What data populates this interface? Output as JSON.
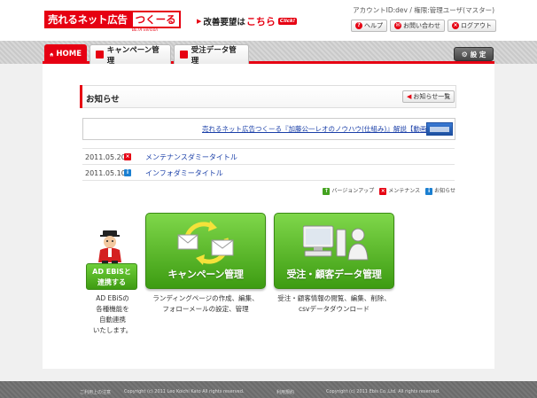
{
  "header": {
    "logo_main": "売れるネット広告",
    "logo_sub": "つくーる",
    "logo_beta": "BETA version",
    "improve_prefix": "改善要望は",
    "improve_link": "こちら",
    "improve_click": "Click!",
    "account": "アカウントID:dev / 権限:管理ユーザ(マスター)",
    "help": "ヘルプ",
    "contact": "お問い合わせ",
    "logout": "ログアウト"
  },
  "nav": {
    "home": "HOME",
    "campaign": "キャンペーン管理",
    "order": "受注データ管理",
    "settings": "設 定"
  },
  "notice": {
    "title": "お知らせ",
    "list_button": "お知らせ一覧",
    "banner_text": "売れるネット広告つくーる『加藤公一レオのノウハウ(仕組み)』解説【動画】",
    "items": [
      {
        "date": "2011.05.20",
        "title": "メンテナンスダミータイトル",
        "color": "#e60012",
        "mark": "×"
      },
      {
        "date": "2011.05.10",
        "title": "インフォダミータイトル",
        "color": "#1a7fd1",
        "mark": "i"
      }
    ],
    "legend": [
      {
        "label": "バージョンアップ",
        "color": "#43a21f",
        "mark": "↑"
      },
      {
        "label": "メンテナンス",
        "color": "#e60012",
        "mark": "×"
      },
      {
        "label": "お知らせ",
        "color": "#1a7fd1",
        "mark": "i"
      }
    ]
  },
  "actions": {
    "ebis_line1": "AD EBiSと",
    "ebis_line2": "連携する",
    "ebis_desc": [
      "AD EBiSの",
      "各種機能を",
      "自動連携",
      "いたします。"
    ],
    "campaign_title": "キャンペーン管理",
    "campaign_desc": [
      "ランディングページの作成、編集、",
      "フォローメールの設定、管理"
    ],
    "order_title": "受注・顧客データ管理",
    "order_desc": [
      "受注・顧客情報の閲覧、編集、削除、",
      "csvデータダウンロード"
    ]
  },
  "footer": {
    "left": "ご利用上の注意",
    "copy1": "Copyright (c) 2011 Leo Koichi Kato All rights reserved.",
    "mid": "利用規約",
    "copy2": "Copyright (c) 2011 Ebis Co.,Ltd. All rights reserved."
  }
}
